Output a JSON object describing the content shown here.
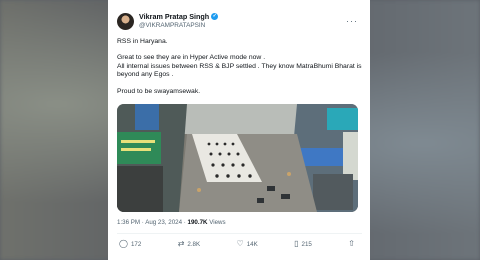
{
  "post": {
    "author_name": "Vikram Pratap Singh",
    "handle": "@VIKRAMPRATAPSIN",
    "paragraphs": [
      "RSS in Haryana.",
      "Great to see they are in Hyper Active mode now .",
      "All internal issues between RSS & BJP settled . They know MatraBhumi Bharat is beyond any Egos .",
      "Proud to be swayamsewak."
    ],
    "timestamp": "1:36 PM · Aug 23, 2024 ·",
    "views_count": "190.7K",
    "views_label": "Views"
  },
  "actions": {
    "replies": "172",
    "reposts": "2.8K",
    "likes": "14K",
    "bookmarks": "215"
  },
  "colors": {
    "verified": "#1d9bf0",
    "text": "#0f1419",
    "secondary": "#536471"
  },
  "icons": [
    "avatar",
    "verified-badge-icon",
    "more-options-icon",
    "reply-icon",
    "repost-icon",
    "like-icon",
    "bookmark-icon",
    "share-icon"
  ]
}
